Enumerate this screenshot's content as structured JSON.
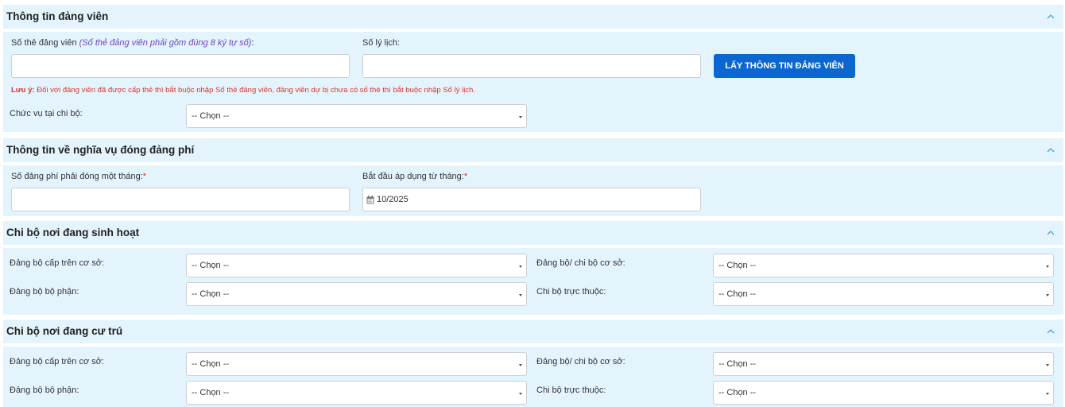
{
  "section1": {
    "title": "Thông tin đảng viên",
    "card_label": "Số thẻ đảng viên",
    "card_hint": "(Số thẻ đảng viên phải gồm đúng 8 ký tự số)",
    "card_suffix": ":",
    "card_value": "",
    "profile_label": "Số lý lịch:",
    "profile_value": "",
    "fetch_button": "LẤY THÔNG TIN ĐẢNG VIÊN",
    "note_prefix": "Lưu ý:",
    "note_text": " Đối với đảng viên đã được cấp thẻ thì bắt buộc nhập Số thẻ đảng viên, đảng viên dự bị chưa có số thẻ thì bắt buộc nhập Số lý lịch.",
    "position_label": "Chức vụ tại chi bộ:",
    "position_value": "-- Chọn --"
  },
  "section2": {
    "title": "Thông tin về nghĩa vụ đóng đảng phí",
    "fee_label": "Số đảng phí phải đóng một tháng:",
    "fee_required": "*",
    "fee_value": "",
    "start_label": "Bắt đầu áp dụng từ tháng:",
    "start_required": "*",
    "start_value": "10/2025"
  },
  "section3": {
    "title": "Chi bộ nơi đang sinh hoạt",
    "upper_label": "Đảng bộ cấp trên cơ sở:",
    "upper_value": "-- Chọn --",
    "base_label": "Đảng bộ/ chi bộ cơ sở:",
    "base_value": "-- Chọn --",
    "dept_label": "Đảng bộ bộ phận:",
    "dept_value": "-- Chọn --",
    "branch_label": "Chi bộ trực thuộc:",
    "branch_value": "-- Chọn --"
  },
  "section4": {
    "title": "Chi bộ nơi đang cư trú",
    "upper_label": "Đảng bộ cấp trên cơ sở:",
    "upper_value": "-- Chọn --",
    "base_label": "Đảng bộ/ chi bộ cơ sở:",
    "base_value": "-- Chọn --",
    "dept_label": "Đảng bộ bộ phận:",
    "dept_value": "-- Chọn --",
    "branch_label": "Chi bộ trực thuộc:",
    "branch_value": "-- Chọn --"
  },
  "icons": {
    "collapse": "chevron-up-icon",
    "calendar": "calendar-icon",
    "dropdown": "caret-down-icon"
  },
  "colors": {
    "panel_bg": "#e4f4fd",
    "primary_button": "#0b66d0",
    "required": "#e0302a",
    "hint": "#6f42c1",
    "note": "#d9342b"
  }
}
